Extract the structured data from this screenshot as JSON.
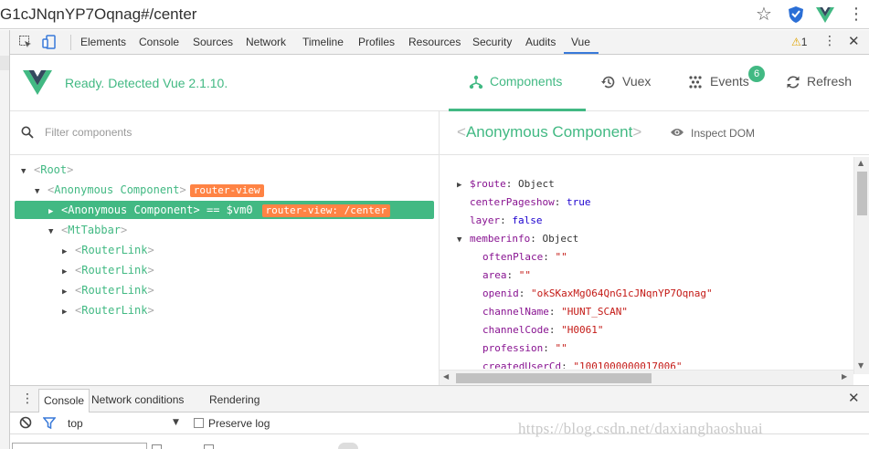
{
  "browser": {
    "url": "G1cJNqnYP7Oqnag#/center"
  },
  "devtools": {
    "tabs": [
      "Elements",
      "Console",
      "Sources",
      "Network",
      "Timeline",
      "Profiles",
      "Resources",
      "Security",
      "Audits",
      "Vue"
    ],
    "active_tab": "Vue",
    "warning_count": "1"
  },
  "vue": {
    "status": "Ready. Detected Vue 2.1.10.",
    "nav": {
      "components": "Components",
      "vuex": "Vuex",
      "events": "Events",
      "events_badge": "6",
      "refresh": "Refresh"
    },
    "filter_placeholder": "Filter components",
    "tree": [
      {
        "arrow": "▼",
        "name": "Root"
      },
      {
        "arrow": "▼",
        "name": "Anonymous Component",
        "tag": "router-view"
      },
      {
        "arrow": "▶",
        "name": "Anonymous Component",
        "suffix": " == $vm0",
        "tag": "router-view: /center",
        "selected": true
      },
      {
        "arrow": "▼",
        "name": "MtTabbar"
      },
      {
        "arrow": "▶",
        "name": "RouterLink"
      },
      {
        "arrow": "▶",
        "name": "RouterLink"
      },
      {
        "arrow": "▶",
        "name": "RouterLink"
      },
      {
        "arrow": "▶",
        "name": "RouterLink"
      }
    ],
    "inspector": {
      "title": "Anonymous Component",
      "inspect_dom": "Inspect DOM",
      "props": [
        {
          "arrow": "▶",
          "key": "$route",
          "value": "Object",
          "kind": "o",
          "indent": 0
        },
        {
          "arrow": "",
          "key": "centerPageshow",
          "value": "true",
          "kind": "b",
          "indent": 0
        },
        {
          "arrow": "",
          "key": "layer",
          "value": "false",
          "kind": "b",
          "indent": 0
        },
        {
          "arrow": "▼",
          "key": "memberinfo",
          "value": "Object",
          "kind": "o",
          "indent": 0
        },
        {
          "arrow": "",
          "key": "oftenPlace",
          "value": "\"\"",
          "kind": "s",
          "indent": 1
        },
        {
          "arrow": "",
          "key": "area",
          "value": "\"\"",
          "kind": "s",
          "indent": 1
        },
        {
          "arrow": "",
          "key": "openid",
          "value": "\"okSKaxMgO64QnG1cJNqnYP7Oqnag\"",
          "kind": "s",
          "indent": 1
        },
        {
          "arrow": "",
          "key": "channelName",
          "value": "\"HUNT_SCAN\"",
          "kind": "s",
          "indent": 1
        },
        {
          "arrow": "",
          "key": "channelCode",
          "value": "\"H0061\"",
          "kind": "s",
          "indent": 1
        },
        {
          "arrow": "",
          "key": "profession",
          "value": "\"\"",
          "kind": "s",
          "indent": 1
        },
        {
          "arrow": "",
          "key": "createdUserCd",
          "value": "\"1001000000017006\"",
          "kind": "s",
          "indent": 1
        }
      ]
    }
  },
  "drawer": {
    "tabs": [
      "Console",
      "Network conditions",
      "Rendering"
    ],
    "context": "top",
    "preserve_log": "Preserve log"
  },
  "watermark": "https://blog.csdn.net/daxianghaoshuai",
  "colors": {
    "vue_green": "#42b983",
    "tag_orange": "#ff8344",
    "devtools_blue": "#3879d9"
  }
}
